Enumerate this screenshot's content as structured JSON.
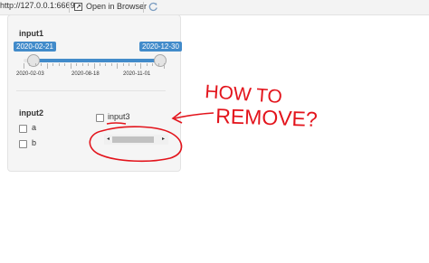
{
  "topbar": {
    "url": "http://127.0.0.1:6669",
    "open_in_browser": "Open in Browser"
  },
  "input1": {
    "label": "input1",
    "value_from": "2020-02-21",
    "value_to": "2020-12-30",
    "tick_labels": [
      "2020-02-03",
      "2020-08-18",
      "2020-11-01"
    ]
  },
  "input2": {
    "label": "input2",
    "options": [
      "a",
      "b"
    ]
  },
  "input3": {
    "label": "input3"
  },
  "scrollbar": {
    "left_arrow": "◂",
    "right_arrow": "▸"
  },
  "annotation": {
    "text_line1": "HOW TO",
    "text_line2": "REMOVE?",
    "color": "#e3141c"
  }
}
